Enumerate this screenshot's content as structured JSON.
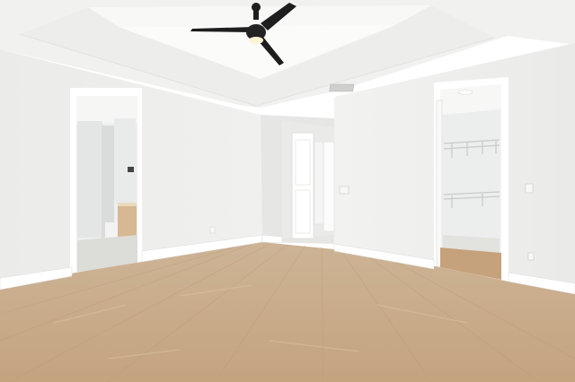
{
  "scene": {
    "kind": "empty-bedroom-photo",
    "colors": {
      "ceiling": "#f3f3f1",
      "tray_ceiling": "#fafaf8",
      "wall_left": "#eeeeec",
      "wall_right": "#f4f4f2",
      "wall_center": "#e9e9e7",
      "trim": "#ffffff",
      "floor_light": "#c9ab8a",
      "floor_dark": "#b9966f",
      "fan": "#1e1e1e",
      "fan_light": "#fff6dc",
      "cabinet": "#d8b994",
      "closet_interior": "#f7f7f7"
    },
    "objects": [
      "ceiling-fan",
      "tray-ceiling",
      "hvac-vent",
      "bathroom-doorway",
      "hallway-doors",
      "walk-in-closet-doorway",
      "closet-shelving",
      "light-switch",
      "outlets",
      "vinyl-plank-floor",
      "baseboards"
    ]
  }
}
